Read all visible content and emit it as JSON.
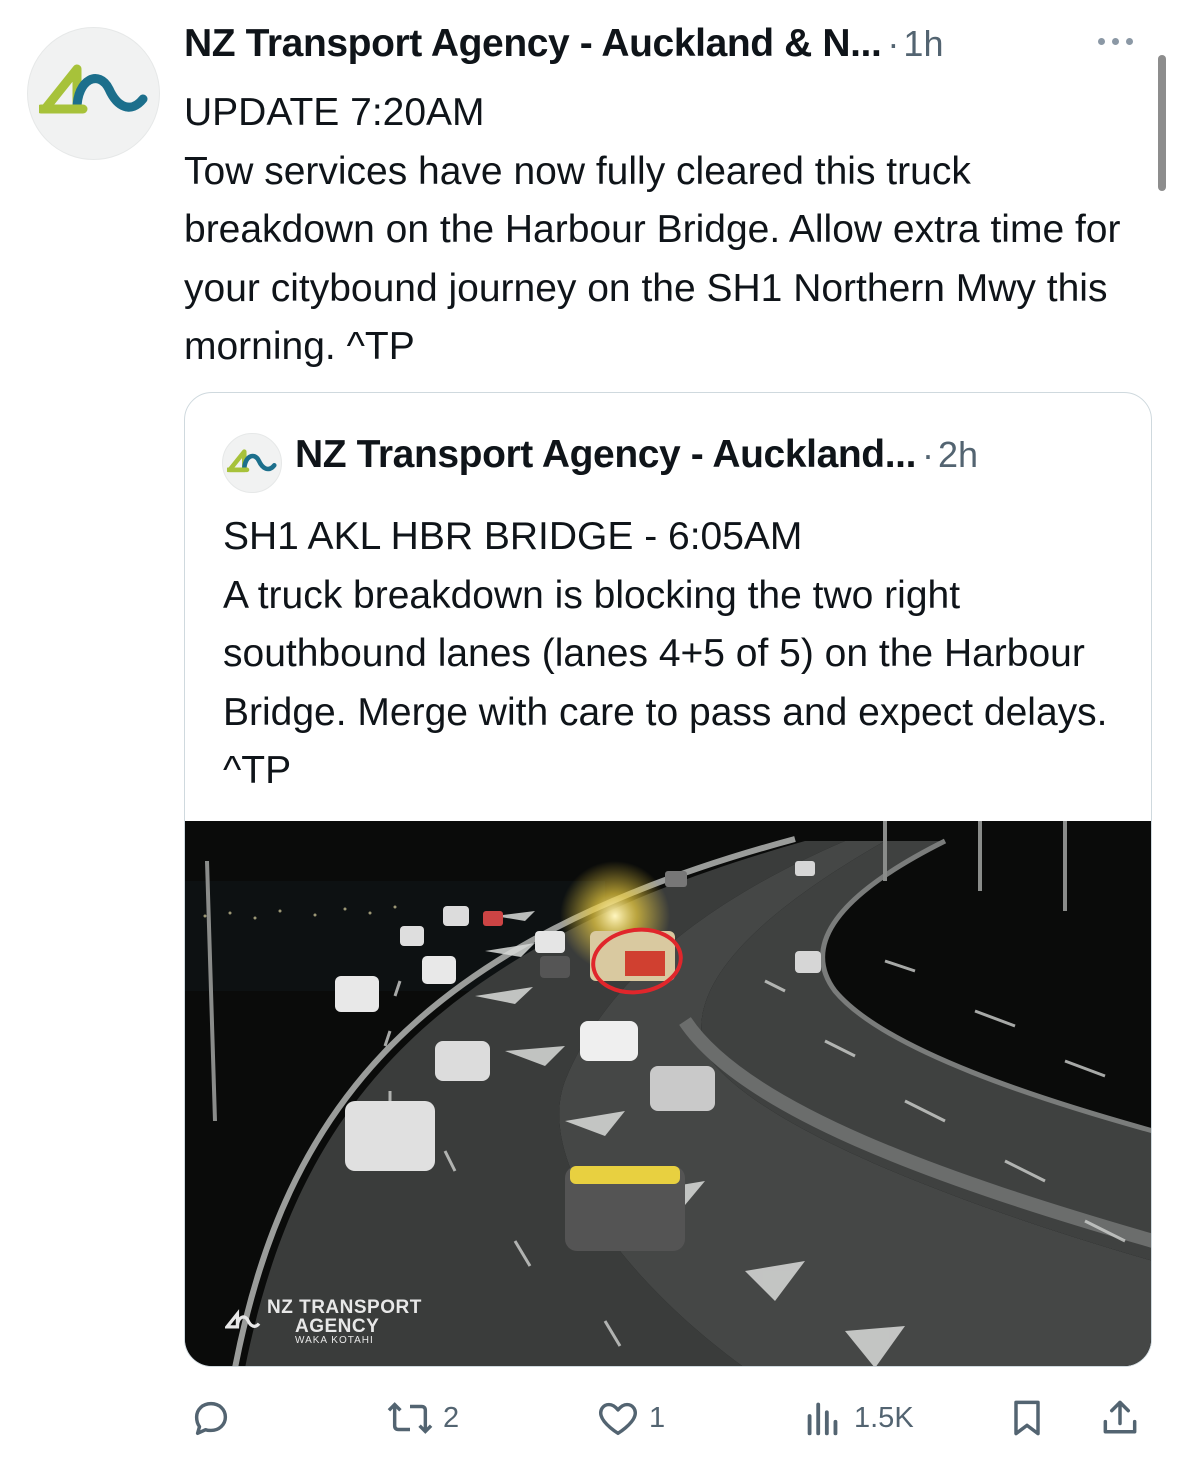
{
  "post": {
    "author": "NZ Transport Agency - Auckland & N...",
    "separator": "·",
    "time": "1h",
    "text": "UPDATE 7:20AM\nTow services have now fully cleared this truck breakdown on the Harbour Bridge. Allow extra time for your citybound journey on the SH1 Northern Mwy this morning. ^TP"
  },
  "quoted": {
    "author": "NZ Transport Agency - Auckland...",
    "separator": "·",
    "time": "2h",
    "text": "SH1 AKL HBR BRIDGE - 6:05AM\nA truck breakdown is blocking the two right southbound lanes (lanes 4+5 of 5) on the Harbour Bridge. Merge with care to pass and expect delays. ^TP",
    "media": {
      "watermark_line1": "NZ TRANSPORT",
      "watermark_line2": "AGENCY",
      "watermark_line3": "WAKA KOTAHI"
    }
  },
  "actions": {
    "replies": "",
    "reposts": "2",
    "likes": "1",
    "views": "1.5K"
  },
  "icons": [
    "logo-icon",
    "more-icon",
    "reply-icon",
    "repost-icon",
    "like-icon",
    "views-icon",
    "bookmark-icon",
    "share-icon"
  ],
  "colors": {
    "logo_lime": "#a7c23a",
    "logo_teal": "#1c6f8c",
    "secondary_text": "#536471",
    "incident_circle": "#e0262b"
  }
}
